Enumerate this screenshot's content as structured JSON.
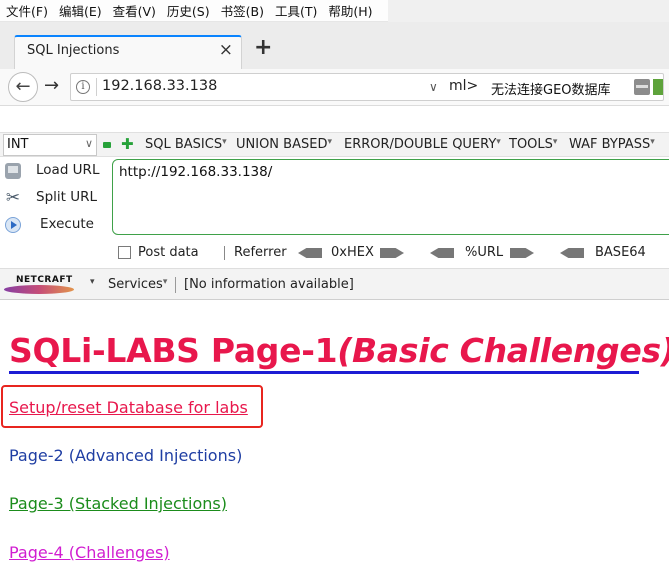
{
  "menubar": {
    "items": [
      "文件(F)",
      "编辑(E)",
      "查看(V)",
      "历史(S)",
      "书签(B)",
      "工具(T)",
      "帮助(H)"
    ]
  },
  "tab": {
    "title": "SQL Injections",
    "close": "×",
    "new_tab": "+"
  },
  "navbar": {
    "url": "192.168.33.138",
    "ml_label": "ml>",
    "geo_text": "无法连接GEO数据库"
  },
  "hackbar": {
    "select_value": "INT",
    "menus": [
      "SQL BASICS",
      "UNION BASED",
      "ERROR/DOUBLE QUERY",
      "TOOLS",
      "WAF BYPASS"
    ],
    "buttons": {
      "load_url": "Load URL",
      "split_url": "Split URL",
      "execute": "Execute"
    },
    "textarea_value": "http://192.168.33.138/",
    "bottom": {
      "post_data": "Post data",
      "referrer": "Referrer",
      "hex": "0xHEX",
      "url": "%URL",
      "base64": "BASE64"
    }
  },
  "netcraft": {
    "logo": "NETCRAFT",
    "services": "Services",
    "info": "[No information available]"
  },
  "content": {
    "title_main": "SQLi-LABS Page-1",
    "title_em": "(Basic Challenges)",
    "links": {
      "setup": "Setup/reset Database for labs",
      "page2": "Page-2 (Advanced Injections)",
      "page3": "Page-3 (Stacked Injections)",
      "page4": "Page-4 (Challenges)"
    }
  },
  "colors": {
    "title": "#e8174c",
    "highlight_box": "#e8251f",
    "page2_link": "#1f3ea3",
    "page3_link": "#1b8c1b",
    "page4_link": "#d11ed1",
    "hackbar_accent": "#27a23a"
  }
}
